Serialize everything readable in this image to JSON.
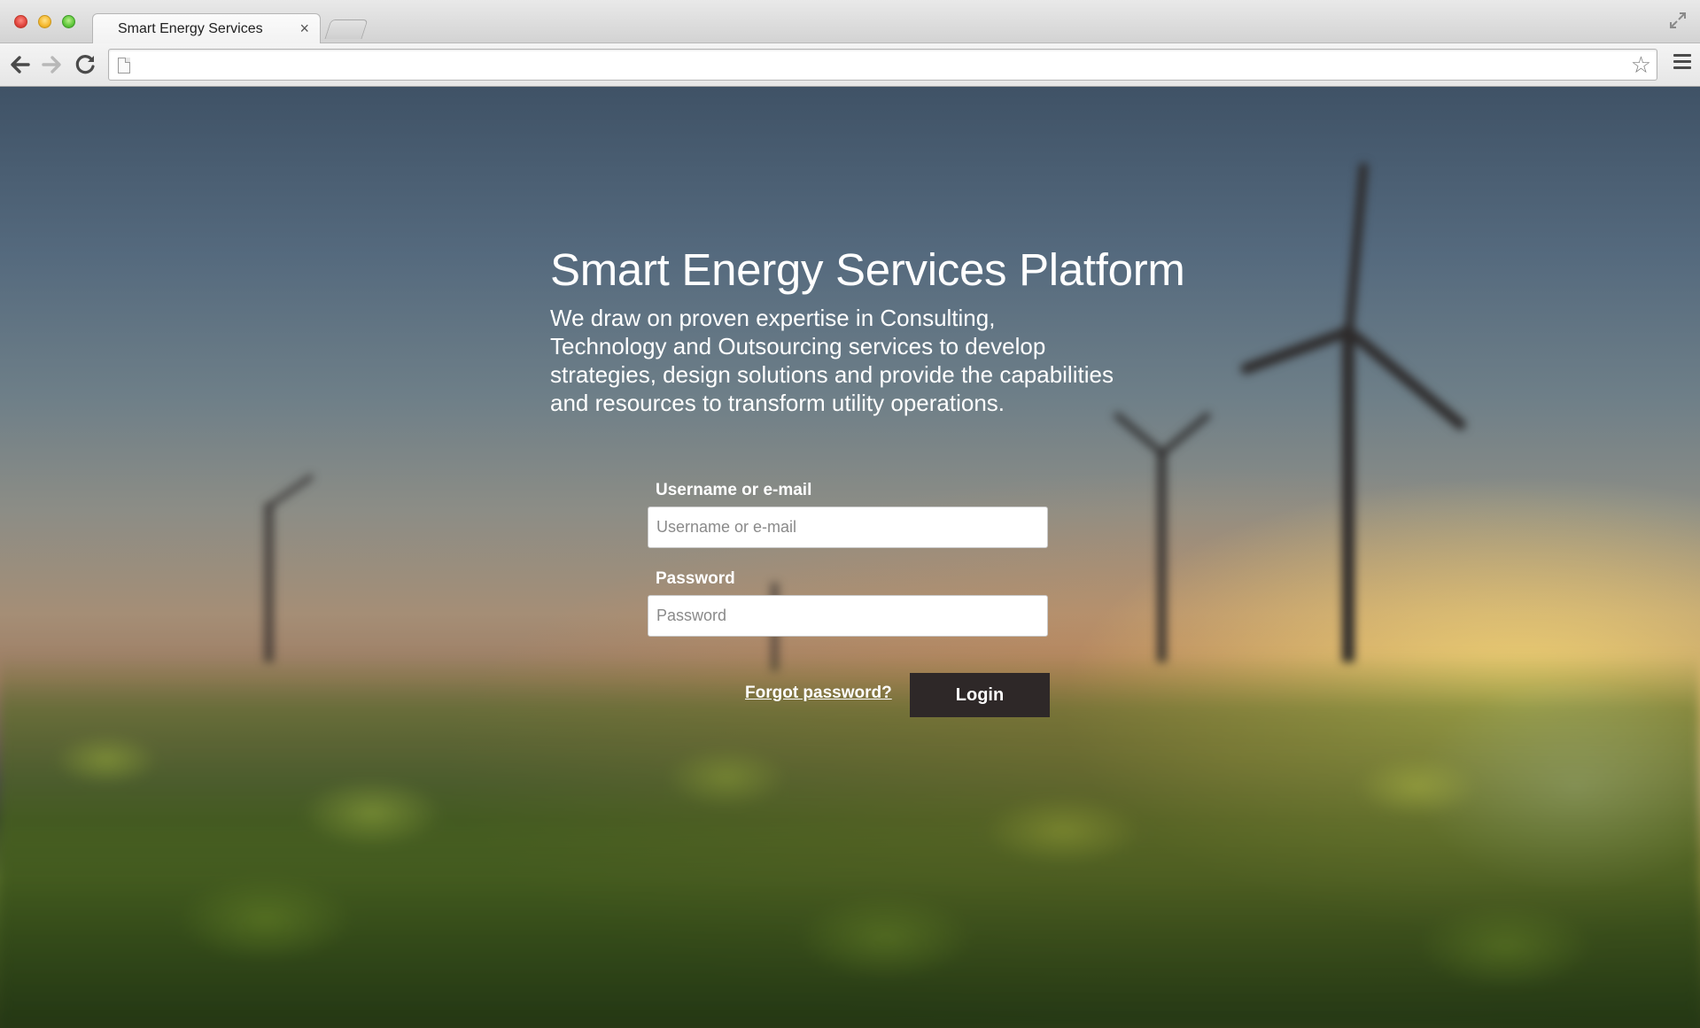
{
  "browser": {
    "tab": {
      "title": "Smart Energy Services",
      "close_glyph": "×"
    },
    "toolbar": {
      "back_icon": "arrow-left-icon",
      "forward_icon": "arrow-right-icon",
      "reload_icon": "reload-icon",
      "url_value": "",
      "bookmark_icon": "star-icon",
      "menu_icon": "hamburger-menu-icon"
    },
    "window_controls": [
      "close",
      "minimize",
      "maximize"
    ]
  },
  "page": {
    "headline": "Smart Energy Services Platform",
    "tagline": "We draw on proven expertise in Consulting, Technology and Outsourcing services to develop strategies, design solutions and provide the capabilities and resources to transform utility operations.",
    "form": {
      "username_label": "Username or e-mail",
      "username_placeholder": "Username or e-mail",
      "username_value": "",
      "password_label": "Password",
      "password_placeholder": "Password",
      "password_value": "",
      "forgot_label": "Forgot password?",
      "login_label": "Login"
    }
  },
  "colors": {
    "button_bg": "#2e2828",
    "text_on_image": "#ffffff",
    "sky_top": "#3f5266",
    "sunset": "#ffd870",
    "field_green": "#556b2a"
  }
}
